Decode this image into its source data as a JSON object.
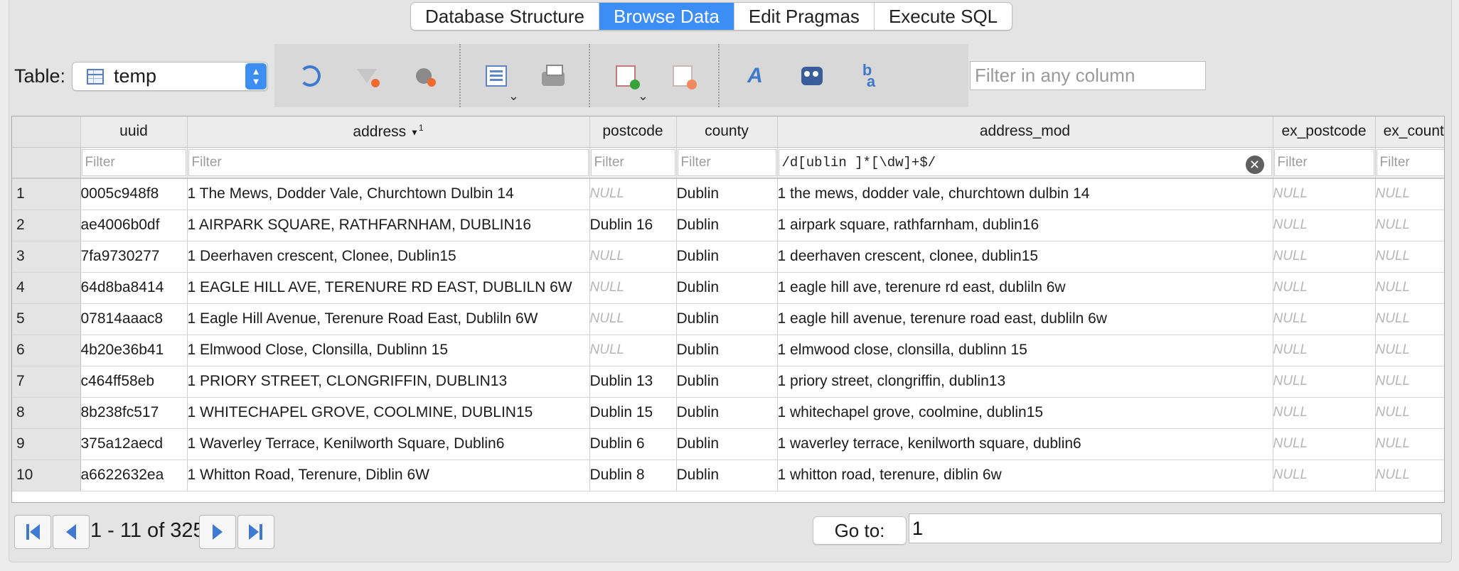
{
  "tabs": [
    {
      "label": "Database Structure",
      "active": false
    },
    {
      "label": "Browse Data",
      "active": true
    },
    {
      "label": "Edit Pragmas",
      "active": false
    },
    {
      "label": "Execute SQL",
      "active": false
    }
  ],
  "toolbar": {
    "table_label": "Table:",
    "table_value": "temp",
    "filter_placeholder": "Filter in any column",
    "icons": [
      "refresh-icon",
      "clear-filters-icon",
      "clear-sort-icon",
      "save-results-icon",
      "print-icon",
      "insert-record-icon",
      "delete-record-icon",
      "font-icon",
      "find-icon",
      "find-replace-icon"
    ]
  },
  "grid": {
    "columns": [
      {
        "name": "uuid",
        "sorted": false
      },
      {
        "name": "address",
        "sorted": true,
        "sort_marker": "▼",
        "sort_order": "1"
      },
      {
        "name": "postcode",
        "sorted": false
      },
      {
        "name": "county",
        "sorted": false
      },
      {
        "name": "address_mod",
        "sorted": false
      },
      {
        "name": "ex_postcode",
        "sorted": false
      },
      {
        "name": "ex_county",
        "sorted": false
      }
    ],
    "filter_placeholder": "Filter",
    "filters": [
      "",
      "",
      "",
      "",
      "/d[ublin ]*[\\dw]+$/",
      "",
      ""
    ],
    "null_text": "NULL",
    "rows": [
      {
        "n": "1",
        "cells": [
          "0005c948f8",
          "1  The Mews, Dodder Vale, Churchtown  Dulbin 14",
          null,
          "Dublin",
          "1  the mews, dodder vale, churchtown  dulbin 14",
          null,
          null
        ]
      },
      {
        "n": "2",
        "cells": [
          "ae4006b0df",
          "1 AIRPARK SQUARE, RATHFARNHAM, DUBLIN16",
          "Dublin 16",
          "Dublin",
          "1 airpark square, rathfarnham, dublin16",
          null,
          null
        ]
      },
      {
        "n": "3",
        "cells": [
          "7fa9730277",
          "1 Deerhaven crescent, Clonee, Dublin15",
          null,
          "Dublin",
          "1 deerhaven crescent, clonee, dublin15",
          null,
          null
        ]
      },
      {
        "n": "4",
        "cells": [
          "64d8ba8414",
          "1 EAGLE HILL AVE, TERENURE RD EAST, DUBLILN 6W",
          null,
          "Dublin",
          "1 eagle hill ave, terenure rd east, dubliln 6w",
          null,
          null
        ]
      },
      {
        "n": "5",
        "cells": [
          "07814aaac8",
          "1 Eagle Hill Avenue, Terenure Road East, Dubliln 6W",
          null,
          "Dublin",
          "1 eagle hill avenue, terenure road east, dubliln 6w",
          null,
          null
        ]
      },
      {
        "n": "6",
        "cells": [
          "4b20e36b41",
          "1 Elmwood Close, Clonsilla, Dublinn 15",
          null,
          "Dublin",
          "1 elmwood close, clonsilla, dublinn 15",
          null,
          null
        ]
      },
      {
        "n": "7",
        "cells": [
          "c464ff58eb",
          "1 PRIORY STREET, CLONGRIFFIN, DUBLIN13",
          "Dublin 13",
          "Dublin",
          "1 priory street, clongriffin, dublin13",
          null,
          null
        ]
      },
      {
        "n": "8",
        "cells": [
          "8b238fc517",
          "1 WHITECHAPEL GROVE, COOLMINE, DUBLIN15",
          "Dublin 15",
          "Dublin",
          "1 whitechapel grove, coolmine, dublin15",
          null,
          null
        ]
      },
      {
        "n": "9",
        "cells": [
          "375a12aecd",
          "1 Waverley Terrace, Kenilworth Square, Dublin6",
          "Dublin 6",
          "Dublin",
          "1 waverley terrace, kenilworth square, dublin6",
          null,
          null
        ]
      },
      {
        "n": "10",
        "cells": [
          "a6622632ea",
          "1 Whitton Road, Terenure, Diblin 6W",
          "Dublin 8",
          "Dublin",
          "1 whitton road, terenure, diblin 6w",
          null,
          null
        ]
      }
    ]
  },
  "footer": {
    "page_info": "1 - 11 of 325",
    "goto_label": "Go to:",
    "goto_value": "1"
  }
}
